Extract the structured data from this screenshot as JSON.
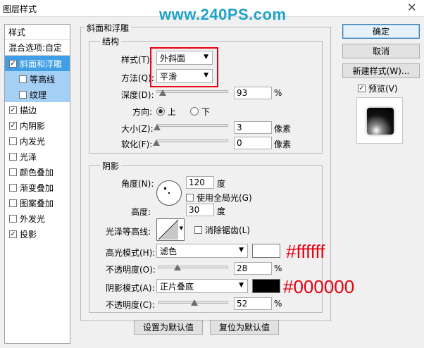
{
  "window": {
    "title": "图层样式",
    "watermark": "www.240PS.com",
    "close_glyph": "✕"
  },
  "styles_panel": {
    "header": "样式",
    "blend_options": "混合选项:自定",
    "items": [
      {
        "label": "斜面和浮雕",
        "checked": true
      },
      {
        "label": "等高线",
        "checked": false
      },
      {
        "label": "纹理",
        "checked": false
      },
      {
        "label": "描边",
        "checked": true
      },
      {
        "label": "内阴影",
        "checked": true
      },
      {
        "label": "内发光",
        "checked": false
      },
      {
        "label": "光泽",
        "checked": false
      },
      {
        "label": "颜色叠加",
        "checked": false
      },
      {
        "label": "渐变叠加",
        "checked": false
      },
      {
        "label": "图案叠加",
        "checked": false
      },
      {
        "label": "外发光",
        "checked": false
      },
      {
        "label": "投影",
        "checked": true
      }
    ]
  },
  "bevel": {
    "section_title": "斜面和浮雕",
    "structure_title": "结构",
    "style_label": "样式(T):",
    "style_value": "外斜面",
    "technique_label": "方法(Q):",
    "technique_value": "平滑",
    "depth_label": "深度(D):",
    "depth_value": "93",
    "depth_unit": "%",
    "direction_label": "方向:",
    "direction_up": "上",
    "direction_down": "下",
    "direction_selected": "上",
    "size_label": "大小(Z):",
    "size_value": "3",
    "size_unit": "像素",
    "soften_label": "软化(F):",
    "soften_value": "0",
    "soften_unit": "像素"
  },
  "shading": {
    "section_title": "阴影",
    "angle_label": "角度(N):",
    "angle_value": "120",
    "angle_unit": "度",
    "global_light_label": "使用全局光(G)",
    "global_light_checked": false,
    "altitude_label": "高度:",
    "altitude_value": "30",
    "altitude_unit": "度",
    "gloss_contour_label": "光泽等高线:",
    "anti_alias_label": "消除锯齿(L)",
    "anti_alias_checked": false,
    "highlight_mode_label": "高光模式(H):",
    "highlight_mode_value": "滤色",
    "highlight_color": "#ffffff",
    "highlight_opacity_label": "不透明度(O):",
    "highlight_opacity_value": "28",
    "highlight_opacity_unit": "%",
    "shadow_mode_label": "阴影模式(A):",
    "shadow_mode_value": "正片叠底",
    "shadow_color": "#000000",
    "shadow_opacity_label": "不透明度(C):",
    "shadow_opacity_value": "52",
    "shadow_opacity_unit": "%"
  },
  "annotations": {
    "highlight_hex": "#ffffff",
    "shadow_hex": "#000000"
  },
  "footer": {
    "make_default": "设置为默认值",
    "reset_default": "复位为默认值"
  },
  "buttons": {
    "ok": "确定",
    "cancel": "取消",
    "new_style": "新建样式(W)...",
    "preview_label": "预览(V)",
    "preview_checked": true
  },
  "sliders": {
    "depth_fraction": 0.09,
    "size_fraction": 0.01,
    "soften_fraction": 0.0,
    "highlight_opacity_fraction": 0.28,
    "shadow_opacity_fraction": 0.52
  }
}
